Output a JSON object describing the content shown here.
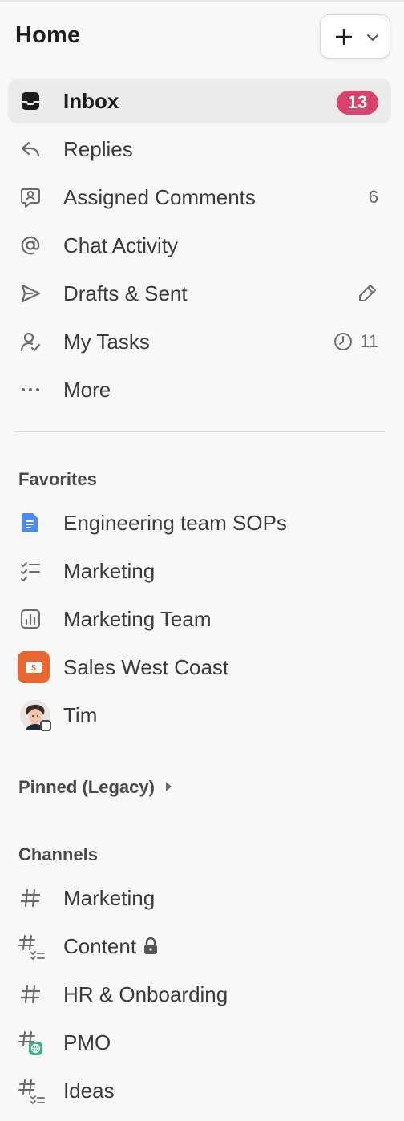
{
  "header": {
    "title": "Home"
  },
  "nav": {
    "items": [
      {
        "label": "Inbox",
        "icon": "inbox-icon",
        "badge": "13"
      },
      {
        "label": "Replies",
        "icon": "reply-icon"
      },
      {
        "label": "Assigned Comments",
        "icon": "comment-assigned-icon",
        "count": "6"
      },
      {
        "label": "Chat Activity",
        "icon": "at-sign-icon"
      },
      {
        "label": "Drafts & Sent",
        "icon": "send-icon",
        "trailing_icon": "pencil-icon"
      },
      {
        "label": "My Tasks",
        "icon": "user-check-icon",
        "count": "11",
        "trailing_icon": "clock-icon"
      },
      {
        "label": "More",
        "icon": "more-dots-icon"
      }
    ]
  },
  "favorites": {
    "heading": "Favorites",
    "items": [
      {
        "label": "Engineering team SOPs",
        "icon": "doc-icon"
      },
      {
        "label": "Marketing",
        "icon": "checklist-icon"
      },
      {
        "label": "Marketing Team",
        "icon": "dashboard-icon"
      },
      {
        "label": "Sales West Coast",
        "icon": "sales-space-icon"
      },
      {
        "label": "Tim",
        "icon": "avatar"
      }
    ]
  },
  "pinned": {
    "heading": "Pinned (Legacy)"
  },
  "channels": {
    "heading": "Channels",
    "items": [
      {
        "label": "Marketing",
        "icon": "hash-icon"
      },
      {
        "label": "Content",
        "icon": "hash-list-icon",
        "trailing_icon": "lock-icon"
      },
      {
        "label": "HR & Onboarding",
        "icon": "hash-icon"
      },
      {
        "label": "PMO",
        "icon": "hash-globe-icon"
      },
      {
        "label": "Ideas",
        "icon": "hash-list-icon"
      }
    ]
  },
  "colors": {
    "badge": "#d8426e",
    "active_bg": "#ebebeb",
    "doc_blue": "#4a8af4",
    "sales_orange": "#e8672e",
    "globe_green": "#3fae84"
  }
}
